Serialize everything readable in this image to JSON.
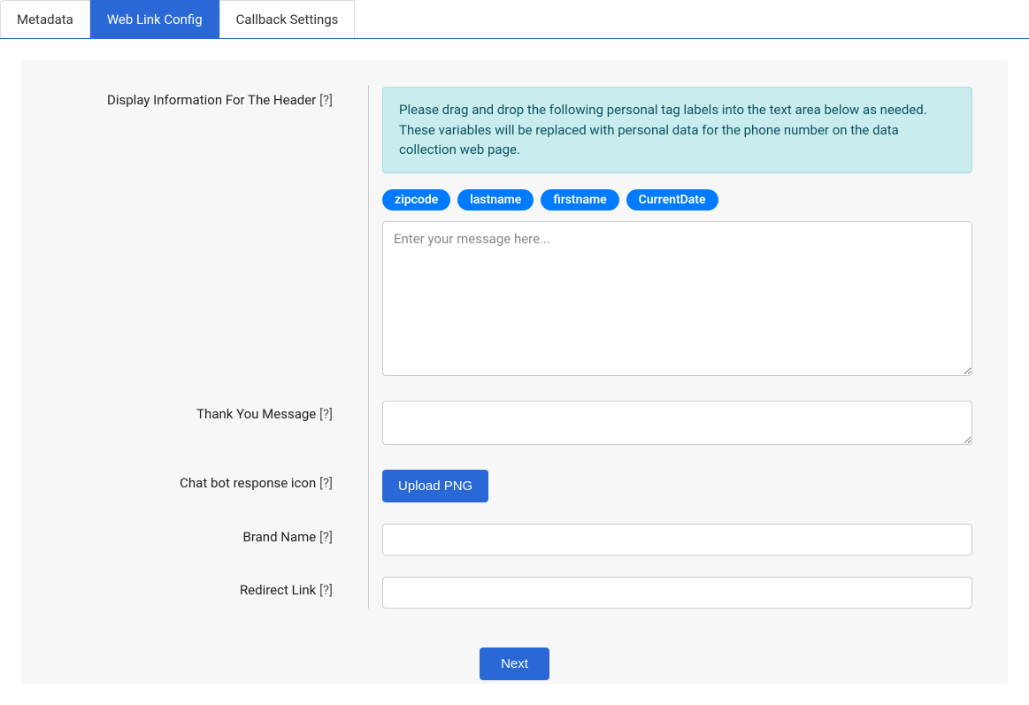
{
  "tabs": {
    "metadata": "Metadata",
    "web_link_config": "Web Link Config",
    "callback_settings": "Callback Settings"
  },
  "labels": {
    "display_header": "Display Information For The Header",
    "thank_you": "Thank You Message",
    "chat_bot_icon": "Chat bot response icon",
    "brand_name": "Brand Name",
    "redirect_link": "Redirect Link",
    "help_suffix": " [?]"
  },
  "info_box": "Please drag and drop the following personal tag labels into the text area below as needed. These variables will be replaced with personal data for the phone number on the data collection web page.",
  "tags": [
    "zipcode",
    "lastname",
    "firstname",
    "CurrentDate"
  ],
  "inputs": {
    "header_msg_placeholder": "Enter your message here...",
    "header_msg_value": "",
    "thank_you_value": "",
    "brand_name_value": "",
    "redirect_link_value": ""
  },
  "buttons": {
    "upload_png": "Upload PNG",
    "next": "Next"
  }
}
